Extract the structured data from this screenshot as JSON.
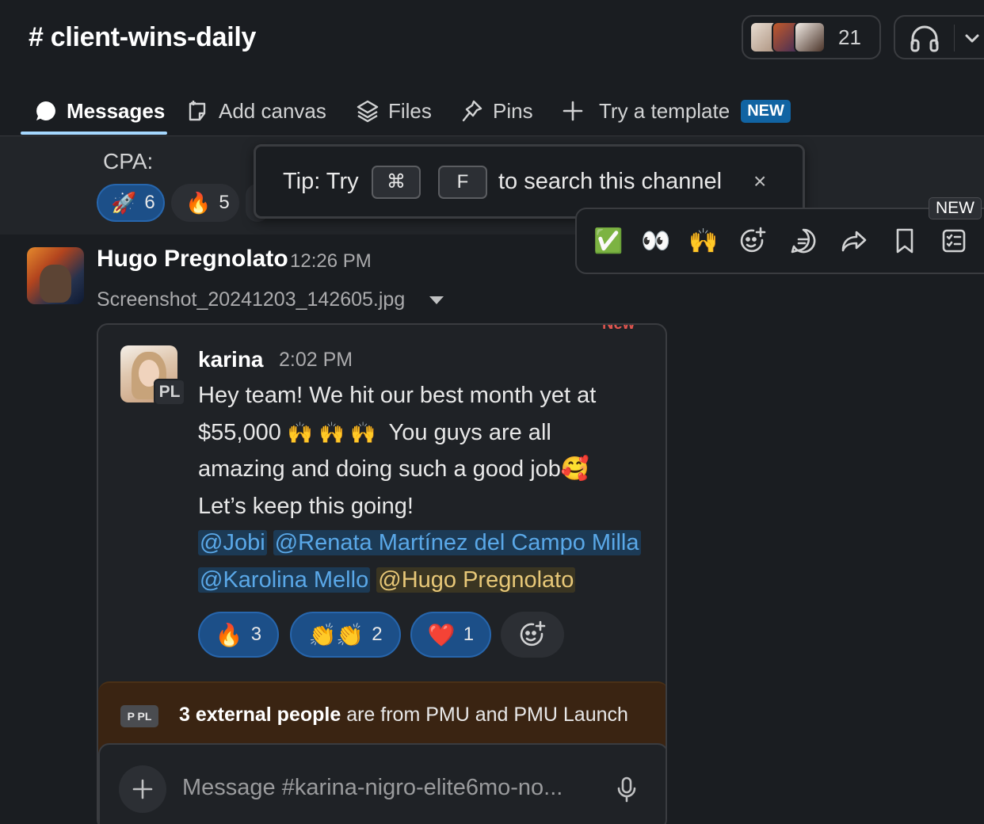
{
  "header": {
    "channel_title": "# client-wins-daily",
    "member_count": "21"
  },
  "tabs": [
    {
      "label": "Messages",
      "icon": "message-bubble-icon",
      "active": true
    },
    {
      "label": "Add canvas",
      "icon": "canvas-icon"
    },
    {
      "label": "Files",
      "icon": "layers-icon"
    },
    {
      "label": "Pins",
      "icon": "pin-icon"
    },
    {
      "label": "Try a template",
      "icon": "plus-icon",
      "badge": "NEW"
    }
  ],
  "previous_message": {
    "text": "CPA:",
    "reactions": [
      {
        "emoji": "🚀",
        "count": "6",
        "reacted": true
      },
      {
        "emoji": "🔥",
        "count": "5",
        "reacted": false
      }
    ]
  },
  "tip": {
    "prefix": "Tip: Try",
    "key1": "⌘",
    "key2": "F",
    "suffix": "to search this channel",
    "close": "×"
  },
  "message_toolbar": {
    "new_badge": "NEW",
    "items": [
      {
        "name": "check-mark-emoji",
        "glyph": "✅"
      },
      {
        "name": "eyes-emoji",
        "glyph": "👀"
      },
      {
        "name": "raised-hands-emoji",
        "glyph": "🙌"
      },
      {
        "name": "add-reaction-icon"
      },
      {
        "name": "reply-thread-icon"
      },
      {
        "name": "forward-icon"
      },
      {
        "name": "bookmark-icon"
      },
      {
        "name": "more-actions-icon"
      }
    ]
  },
  "message": {
    "sender": "Hugo Pregnolato",
    "time": "12:26 PM",
    "attachment_name": "Screenshot_20241203_142605.jpg"
  },
  "screenshot": {
    "top_fragment": "New",
    "sender": "karina",
    "time": "2:02 PM",
    "avatar_badge": "PL",
    "body_line1": "Hey team! We hit our best month yet at",
    "body_amount": "$55,000",
    "body_emoji": "🙌 🙌 🙌",
    "body_line2b": "You guys are all",
    "body_line3": "amazing and doing such a good job",
    "body_emoji2": "🥰",
    "body_line4": "Let’s keep this going!",
    "mentions": [
      "@Jobi",
      "@Renata Martínez del Campo Milla",
      "@Karolina Mello",
      "@Hugo Pregnolato"
    ],
    "reactions": [
      {
        "emoji": "🔥",
        "count": "3"
      },
      {
        "emoji": "👏👏",
        "count": "2"
      },
      {
        "emoji": "❤️",
        "count": "1"
      }
    ],
    "external_badge": "P PL",
    "external_bold": "3 external people",
    "external_rest": "are from PMU and PMU Launch",
    "composer_placeholder": "Message #karina-nigro-elite6mo-no..."
  }
}
